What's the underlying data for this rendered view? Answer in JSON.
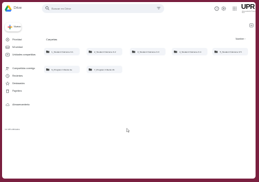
{
  "header": {
    "app_title": "Drive",
    "search_placeholder": "Buscar en Drive",
    "brand": "UPR",
    "brand_sub": "Universidad de Puerto Rico"
  },
  "sidebar": {
    "new_label": "Nuevo",
    "items": [
      {
        "label": "Prioridad",
        "icon": "home-icon"
      },
      {
        "label": "Mi unidad",
        "icon": "drive-icon"
      },
      {
        "label": "Unidades compartidas",
        "icon": "shared-drives-icon"
      },
      {
        "label": "Compartidos conmigo",
        "icon": "people-icon"
      },
      {
        "label": "Recientes",
        "icon": "clock-icon"
      },
      {
        "label": "Destacados",
        "icon": "star-icon"
      },
      {
        "label": "Papelera",
        "icon": "trash-icon"
      },
      {
        "label": "Almacenamiento",
        "icon": "cloud-icon"
      }
    ],
    "storage_text": "12 GB utilizados"
  },
  "main": {
    "section_title": "Carpetas",
    "sort_label": "Nombre ↑",
    "folders": [
      {
        "name": "1_Student Outcome 3.1"
      },
      {
        "name": "2_Student Outcome 3.2"
      },
      {
        "name": "3_Student Outcome 3.3"
      },
      {
        "name": "4_Student Outcome 3.4"
      },
      {
        "name": "5_Student Outcome 3.5"
      },
      {
        "name": "6_Program Criteria 4a"
      },
      {
        "name": "7_Program Criteria 4b"
      }
    ]
  },
  "colors": {
    "background_border": "#7a2040",
    "surface": "#ffffff",
    "search_bg": "#eef1f6",
    "folder_icon": "#444746",
    "folder_bg": "#f2f4f8"
  }
}
